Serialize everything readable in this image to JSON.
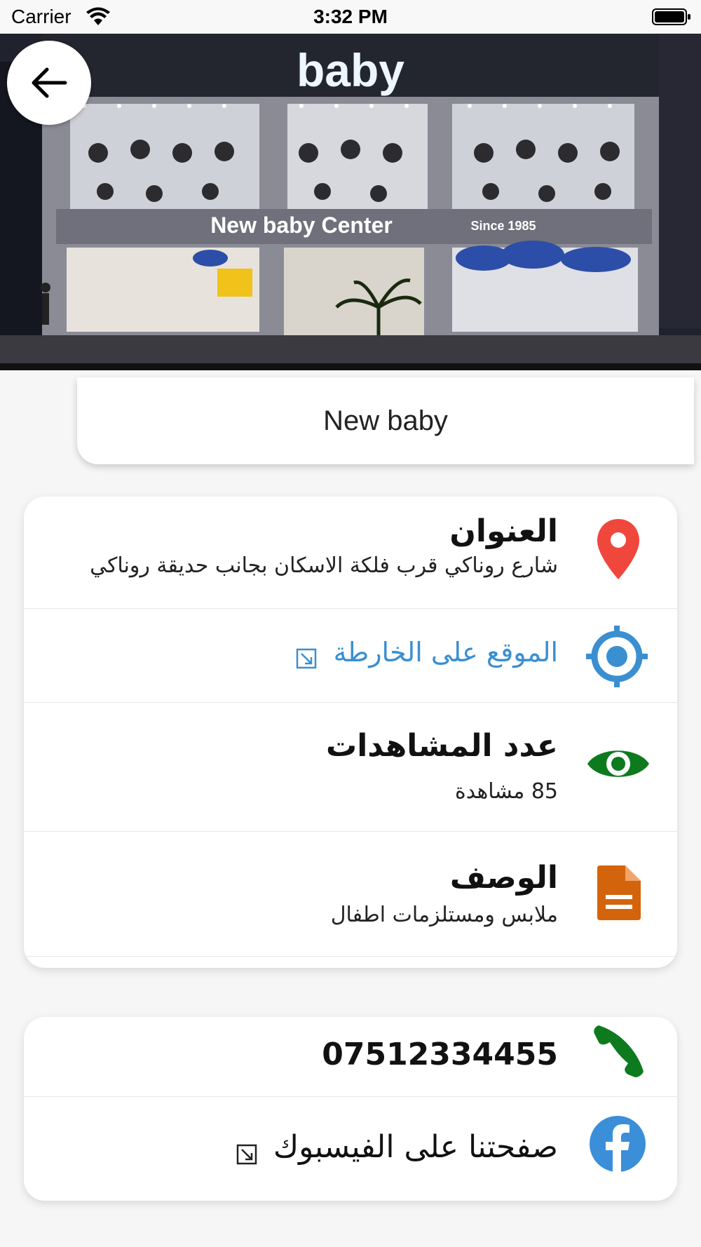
{
  "status_bar": {
    "carrier": "Carrier",
    "time": "3:32 PM"
  },
  "hero": {
    "sign_logo": "baby",
    "sign_center": "New baby Center",
    "sign_since": "Since 1985"
  },
  "shop": {
    "name": "New baby"
  },
  "info": {
    "address_title": "العنوان",
    "address_value": "شارع روناكي قرب فلكة الاسكان بجانب حديقة روناكي",
    "map_link": "الموقع على الخارطة",
    "views_title": "عدد المشاهدات",
    "views_value": "85 مشاهدة",
    "description_title": "الوصف",
    "description_value": "ملابس ومستلزمات اطفال"
  },
  "contact": {
    "phone": "07512334455",
    "facebook_link": "صفحتنا على الفيسبوك"
  },
  "colors": {
    "location_pin": "#f0473d",
    "map_target": "#3a8fd1",
    "eye": "#0d7a1e",
    "document": "#d4640c",
    "phone": "#0d7a1e",
    "facebook": "#3b8fd8"
  },
  "icons": [
    "back-arrow-icon",
    "location-pin-icon",
    "crosshair-icon",
    "eye-icon",
    "document-icon",
    "phone-icon",
    "facebook-icon",
    "external-link-icon"
  ]
}
